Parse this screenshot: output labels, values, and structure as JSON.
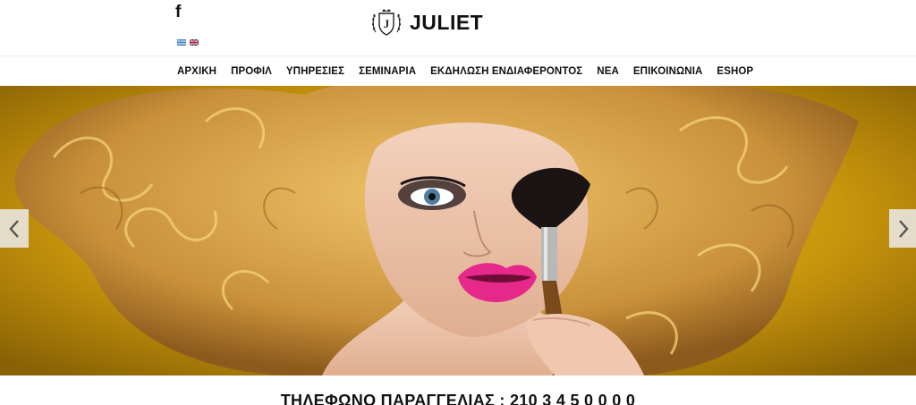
{
  "header": {
    "facebook_glyph": "f",
    "languages": [
      "el",
      "en"
    ],
    "logo_text": "JULIET",
    "logo_emblem_letter": "J"
  },
  "nav": {
    "items": [
      {
        "label": "ΑΡΧΙΚΗ"
      },
      {
        "label": "ΠΡΟΦΙΛ"
      },
      {
        "label": "ΥΠΗΡΕΣΙΕΣ"
      },
      {
        "label": "ΣΕΜΙΝΑΡΙΑ"
      },
      {
        "label": "ΕΚΔΗΛΩΣΗ ΕΝΔΙΑΦΕΡΟΝΤΟΣ"
      },
      {
        "label": "ΝΕΑ"
      },
      {
        "label": "ΕΠΙΚΟΙΝΩΝΙΑ"
      },
      {
        "label": "ESHOP"
      }
    ]
  },
  "hero": {
    "prev_icon": "chevron-left-icon",
    "next_icon": "chevron-right-icon",
    "colors": {
      "background": "#c89a0c",
      "hair": "#d9a84a",
      "lips": "#e6288a",
      "arrow_bg": "#ebebeb"
    }
  },
  "phone": {
    "text": "ΤΗΛΕΦΩΝΟ ΠΑΡΑΓΓΕΛΙΑΣ : 210 3 4 5 0 0 0 0"
  }
}
